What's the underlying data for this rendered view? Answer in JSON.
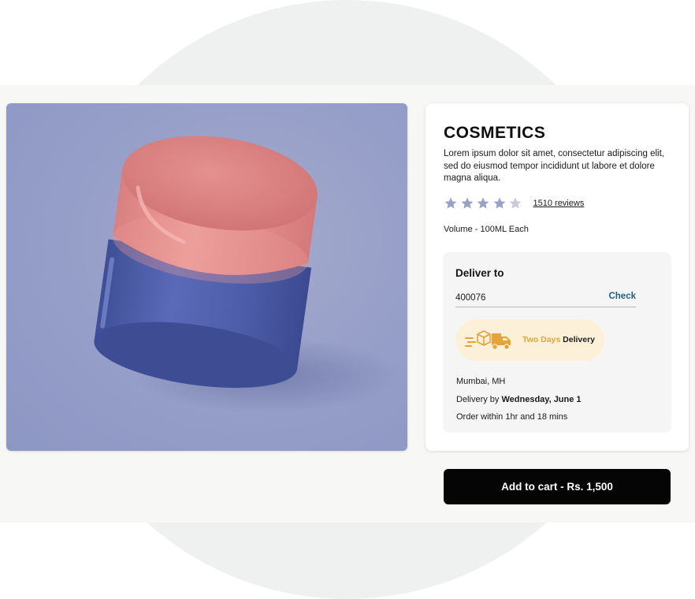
{
  "product": {
    "title": "COSMETICS",
    "description": "Lorem ipsum dolor sit amet, consectetur adipiscing elit, sed do eiusmod tempor incididunt ut labore et dolore magna aliqua.",
    "rating": {
      "value": 4,
      "max": 5,
      "reviews_label": "1510 reviews"
    },
    "volume": "Volume - 100ML Each",
    "image_icon": "cosmetic-jar-image"
  },
  "delivery": {
    "heading": "Deliver to",
    "pincode_value": "400076",
    "check_label": "Check",
    "badge": {
      "accent_text": "Two Days",
      "bold_text": "Delivery",
      "icon": "delivery-truck-icon"
    },
    "location": "Mumbai, MH",
    "delivery_by_prefix": "Delivery by",
    "delivery_date": "Wednesday, June 1",
    "order_within": "Order within 1hr and 18 mins"
  },
  "cart": {
    "label": "Add to cart - Rs. 1,500"
  },
  "colors": {
    "star_filled": "#9ca0c4",
    "star_empty": "#c9cad6",
    "check_link": "#1f5f86",
    "badge_bg": "#fdf0d9",
    "badge_accent": "#e5a43a",
    "button_bg": "#050505"
  }
}
